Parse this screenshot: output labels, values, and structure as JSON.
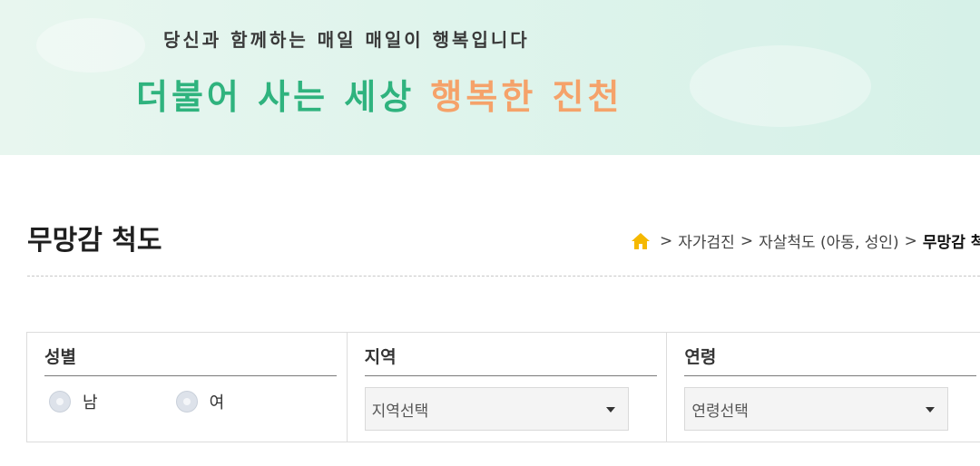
{
  "banner": {
    "tagline": "당신과 함께하는 매일 매일이 행복입니다",
    "slogan_main": "더불어 사는 세상",
    "slogan_accent": "행복한 진천"
  },
  "page": {
    "title": "무망감 척도"
  },
  "breadcrumb": {
    "items": [
      "자가검진",
      "자살척도 (아동, 성인)",
      "무망감 척도"
    ],
    "separator": ">",
    "home_icon": "home-icon"
  },
  "filters": {
    "gender": {
      "label": "성별",
      "options": [
        "남",
        "여"
      ]
    },
    "region": {
      "label": "지역",
      "placeholder": "지역선택"
    },
    "age": {
      "label": "연령",
      "placeholder": "연령선택"
    }
  },
  "colors": {
    "slogan_green": "#2fb37e",
    "slogan_orange": "#f5a26a",
    "home_icon": "#f5b800"
  }
}
